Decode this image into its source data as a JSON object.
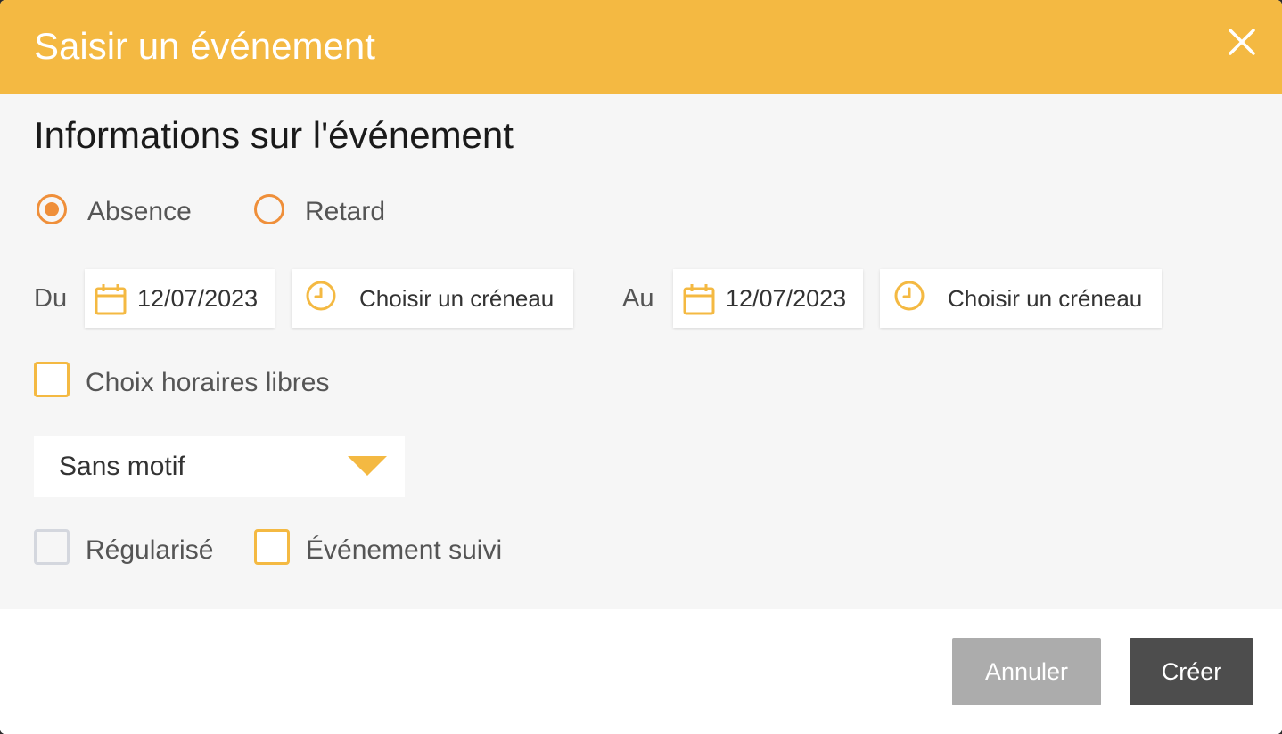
{
  "header": {
    "title": "Saisir un événement",
    "close_icon": "close-icon"
  },
  "section": {
    "title": "Informations sur l'événement"
  },
  "event_type": {
    "selected": "Absence",
    "options": [
      "Absence",
      "Retard"
    ]
  },
  "period": {
    "from_label": "Du",
    "from_date": "12/07/2023",
    "from_slot": "Choisir un créneau",
    "to_label": "Au",
    "to_date": "12/07/2023",
    "to_slot": "Choisir un créneau"
  },
  "free_hours": {
    "label": "Choix horaires libres",
    "checked": false
  },
  "reason": {
    "selected": "Sans motif"
  },
  "flags": {
    "regularised_label": "Régularisé",
    "regularised_checked": false,
    "regularised_disabled": true,
    "followed_label": "Événement suivi",
    "followed_checked": false
  },
  "footer": {
    "cancel_label": "Annuler",
    "create_label": "Créer"
  },
  "colors": {
    "header_bg": "#f4b942",
    "radio_accent": "#ef8f3a",
    "icon_accent": "#f4b942",
    "cancel_bg": "#acacac",
    "create_bg": "#4d4d4d"
  }
}
